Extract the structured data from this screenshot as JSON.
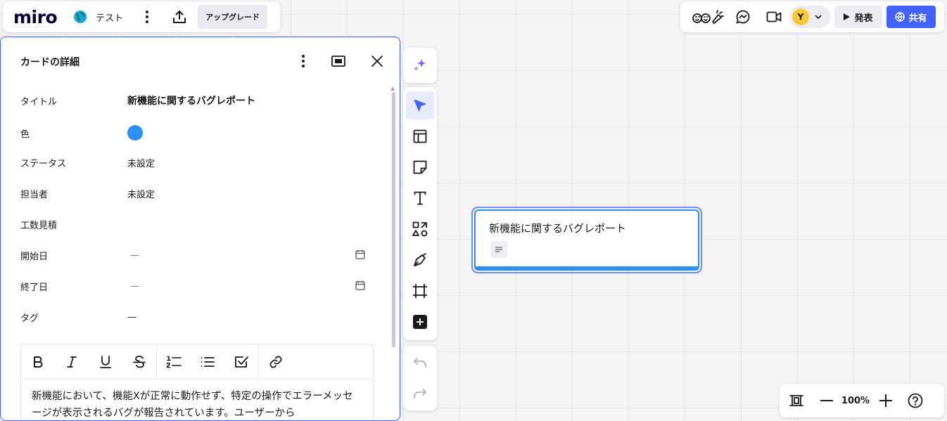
{
  "header": {
    "logo": "miro",
    "board_name": "テスト",
    "upgrade_label": "アップグレード"
  },
  "topright": {
    "avatar_initial": "Y",
    "present_label": "発表",
    "share_label": "共有"
  },
  "card_panel": {
    "title": "カードの詳細",
    "fields": {
      "title_label": "タイトル",
      "title_value": "新機能に関するバグレポート",
      "color_label": "色",
      "color_value": "#2d8ff7",
      "status_label": "ステータス",
      "status_value": "未設定",
      "assignee_label": "担当者",
      "assignee_value": "未設定",
      "estimate_label": "工数見積",
      "start_label": "開始日",
      "start_value": "—",
      "end_label": "終了日",
      "end_value": "—",
      "tags_label": "タグ",
      "tags_value": "—"
    },
    "description": "新機能において、機能Xが正常に動作せず、特定の操作でエラーメッセージが表示されるバグが報告されています。ユーザーから"
  },
  "canvas_card": {
    "title": "新機能に関するバグレポート"
  },
  "zoom": {
    "level": "100%"
  },
  "colors": {
    "accent": "#4262ff",
    "card_blue": "#2d8ff7",
    "ai_purple": "#8a5cf6"
  },
  "icons": [
    "globe-icon",
    "more-vertical-icon",
    "export-icon",
    "reactions-icon",
    "comments-icon",
    "video-call-icon",
    "chevron-down-icon",
    "play-icon",
    "share-globe-icon",
    "maximize-icon",
    "close-icon",
    "calendar-icon",
    "bold-icon",
    "italic-icon",
    "underline-icon",
    "strikethrough-icon",
    "numbered-list-icon",
    "bullet-list-icon",
    "checklist-icon",
    "link-icon",
    "ai-sparkle-icon",
    "select-cursor-icon",
    "templates-icon",
    "sticky-note-icon",
    "text-icon",
    "shapes-icon",
    "pen-icon",
    "frame-icon",
    "more-tools-icon",
    "undo-icon",
    "redo-icon",
    "fit-to-screen-icon",
    "zoom-out-icon",
    "zoom-in-icon",
    "help-icon",
    "description-icon"
  ]
}
